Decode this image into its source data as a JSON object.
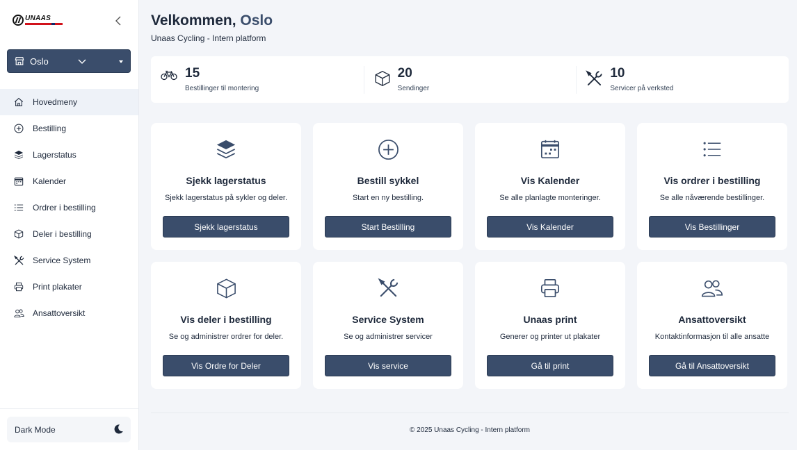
{
  "sidebar": {
    "logo_text": "UNAAS",
    "store": {
      "selected": "Oslo"
    },
    "items": [
      {
        "label": "Hovedmeny",
        "icon": "home-icon",
        "active": true
      },
      {
        "label": "Bestilling",
        "icon": "plus-circle-icon"
      },
      {
        "label": "Lagerstatus",
        "icon": "layers-icon"
      },
      {
        "label": "Kalender",
        "icon": "calendar-icon"
      },
      {
        "label": "Ordrer i bestilling",
        "icon": "list-icon"
      },
      {
        "label": "Deler i bestilling",
        "icon": "box-icon"
      },
      {
        "label": "Service System",
        "icon": "tools-icon"
      },
      {
        "label": "Print plakater",
        "icon": "printer-icon"
      },
      {
        "label": "Ansattoversikt",
        "icon": "users-icon"
      }
    ],
    "dark_mode_label": "Dark Mode"
  },
  "header": {
    "welcome_prefix": "Velkommen, ",
    "city": "Oslo",
    "subtitle": "Unaas Cycling - Intern platform"
  },
  "stats": [
    {
      "value": "15",
      "label": "Bestillinger til montering",
      "icon": "bicycle-icon"
    },
    {
      "value": "20",
      "label": "Sendinger",
      "icon": "box-icon"
    },
    {
      "value": "10",
      "label": "Servicer på verksted",
      "icon": "tools-icon"
    }
  ],
  "cards": [
    {
      "title": "Sjekk lagerstatus",
      "desc": "Sjekk lagerstatus på sykler og deler.",
      "button": "Sjekk lagerstatus",
      "icon": "layers-icon"
    },
    {
      "title": "Bestill sykkel",
      "desc": "Start en ny bestilling.",
      "button": "Start Bestilling",
      "icon": "plus-circle-icon"
    },
    {
      "title": "Vis Kalender",
      "desc": "Se alle planlagte monteringer.",
      "button": "Vis Kalender",
      "icon": "calendar-icon"
    },
    {
      "title": "Vis ordrer i bestilling",
      "desc": "Se alle nåværende bestillinger.",
      "button": "Vis Bestillinger",
      "icon": "list-icon"
    },
    {
      "title": "Vis deler i bestilling",
      "desc": "Se og administrer ordrer for deler.",
      "button": "Vis Ordre for Deler",
      "icon": "box-icon"
    },
    {
      "title": "Service System",
      "desc": "Se og administrer servicer",
      "button": "Vis service",
      "icon": "tools-icon"
    },
    {
      "title": "Unaas print",
      "desc": "Generer og printer ut plakater",
      "button": "Gå til print",
      "icon": "printer-icon"
    },
    {
      "title": "Ansattoversikt",
      "desc": "Kontaktinformasjon til alle ansatte",
      "button": "Gå til Ansattoversikt",
      "icon": "users-icon"
    }
  ],
  "footer": "© 2025 Unaas Cycling - Intern platform",
  "colors": {
    "primary": "#3a4d6b",
    "background": "#f3f5f9",
    "text": "#1e293b"
  }
}
